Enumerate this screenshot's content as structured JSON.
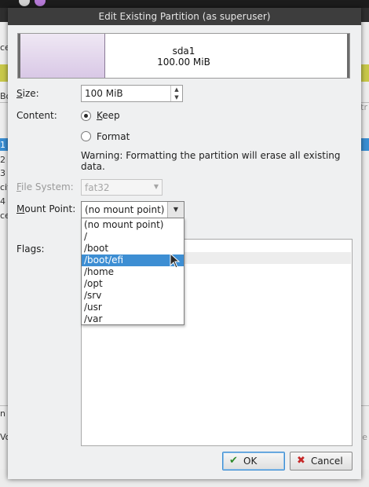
{
  "background": {
    "left_fragments": [
      "ce",
      "Bo",
      "1",
      "2",
      "3",
      "cit",
      "4",
      "ce",
      "n",
      "Vo"
    ],
    "right_fragments": [
      "str",
      "e"
    ]
  },
  "dialog": {
    "title": "Edit Existing Partition (as superuser)",
    "partition": {
      "name": "sda1",
      "size": "100.00 MiB"
    },
    "size_label_prefix": "S",
    "size_label_rest": "ize:",
    "size_value": "100 MiB",
    "content_label": "Content:",
    "keep_label_u": "K",
    "keep_label_rest": "eep",
    "format_label": "Format",
    "warning": "Warning: Formatting the partition will erase all existing data.",
    "fs_label_prefix": "F",
    "fs_label_rest": "ile System:",
    "fs_value": "fat32",
    "mount_label_prefix": "M",
    "mount_label_rest": "ount Point:",
    "mount_value": "(no mount point)",
    "mount_options": [
      "(no mount point)",
      "/",
      "/boot",
      "/boot/efi",
      "/home",
      "/opt",
      "/srv",
      "/usr",
      "/var"
    ],
    "mount_highlighted": "/boot/efi",
    "flags_label": "Flags:",
    "ok_label": "OK",
    "cancel_label": "Cancel"
  }
}
